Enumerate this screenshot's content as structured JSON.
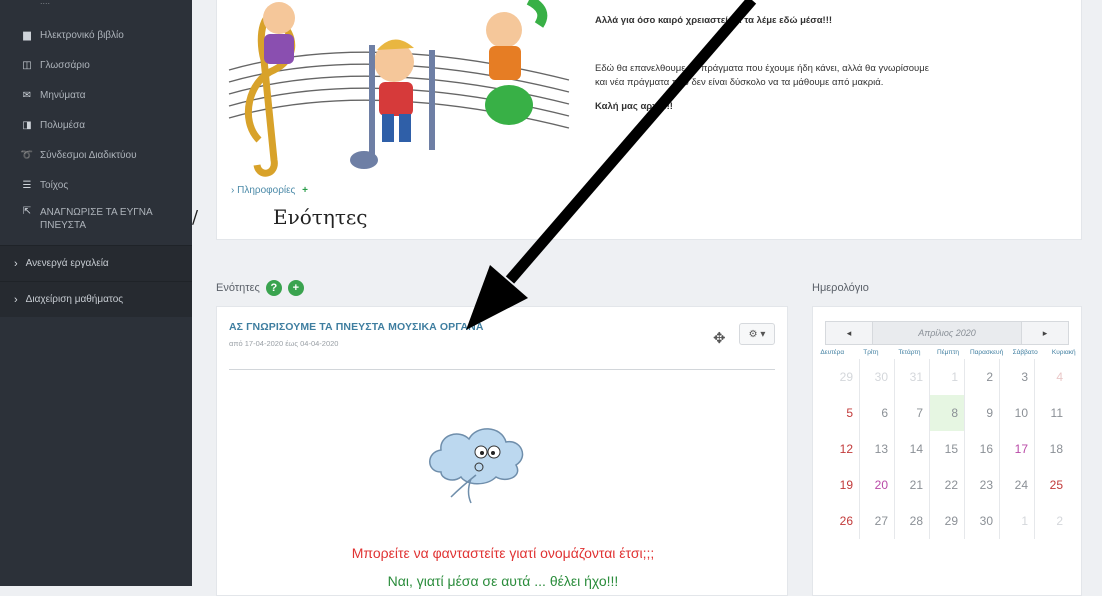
{
  "sidebar": {
    "top_partial": "....",
    "items": [
      {
        "icon": "book-icon",
        "glyph": "▆",
        "label": "Ηλεκτρονικό βιβλίο"
      },
      {
        "icon": "glossary-icon",
        "glyph": "◫",
        "label": "Γλωσσάριο"
      },
      {
        "icon": "message-icon",
        "glyph": "✉",
        "label": "Μηνύματα"
      },
      {
        "icon": "tools-icon",
        "glyph": "◨",
        "label": "Πολυμέσα"
      },
      {
        "icon": "link-icon",
        "glyph": "➰",
        "label": "Σύνδεσμοι Διαδικτύου"
      },
      {
        "icon": "wall-icon",
        "glyph": "☰",
        "label": "Τοίχος"
      },
      {
        "icon": "external-icon",
        "glyph": "⇱",
        "label": "ΑΝΑΓΝΩΡΙΣΕ ΤΑ ΕΥΓΝΑ ΠΝΕΥΣΤΑ"
      }
    ],
    "sections": [
      {
        "label": "Ανενεργά εργαλεία"
      },
      {
        "label": "Διαχείριση μαθήματος"
      }
    ]
  },
  "stray_mark": "/",
  "top_panel": {
    "lines": [
      {
        "text": "Αλλά για όσο καιρό χρειαστεί θα τα λέμε εδώ μέσα!!!",
        "bold": true
      },
      {
        "text": "Εδώ θα επανελθουμε σε πράγματα που έχουμε ήδη κάνει, αλλά θα γνωρίσουμε",
        "bold": false
      },
      {
        "text": "και νέα πράγματα που δεν είναι δύσκολο να τα μάθουμε από μακριά.",
        "bold": false
      },
      {
        "text": "Καλή μας αρχή!!!",
        "bold": true
      }
    ],
    "info_label": "Πληροφορίες",
    "handwritten_label": "Ενότητες"
  },
  "sections_panel": {
    "title": "Ενότητες",
    "help_glyph": "?",
    "add_glyph": "+",
    "unit": {
      "title": "ΑΣ ΓΝΩΡΙΣΟΥΜΕ ΤΑ ΠΝΕΥΣΤΑ ΜΟΥΣΙΚΑ ΟΡΓΑΝΑ",
      "date": "από 17-04-2020 έως 04-04-2020",
      "move_glyph": "✥",
      "gear_label": "⚙ ▾",
      "red_text": "Μπορείτε να φανταστείτε γιατί ονομάζονται έτσι;;;",
      "green_text": "Ναι, γιατί μέσα σε αυτά ... θέλει ήχο!!!"
    }
  },
  "calendar": {
    "title": "Ημερολόγιο",
    "prev": "◂",
    "next": "▸",
    "month": "Απρίλιος 2020",
    "weekdays": [
      "Δευτέρα",
      "Τρίτη",
      "Τετάρτη",
      "Πέμπτη",
      "Παρασκευή",
      "Σάββατο",
      "Κυριακή"
    ],
    "weeks": [
      [
        {
          "d": "29",
          "t": "other"
        },
        {
          "d": "30",
          "t": "other"
        },
        {
          "d": "31",
          "t": "other"
        },
        {
          "d": "1",
          "t": "other"
        },
        {
          "d": "2"
        },
        {
          "d": "3"
        },
        {
          "d": "4",
          "t": "other sun"
        }
      ],
      [
        {
          "d": "5",
          "t": "sun"
        },
        {
          "d": "6"
        },
        {
          "d": "7"
        },
        {
          "d": "8",
          "t": "today"
        },
        {
          "d": "9"
        },
        {
          "d": "10"
        },
        {
          "d": "11"
        }
      ],
      [
        {
          "d": "12",
          "t": "sun"
        },
        {
          "d": "13"
        },
        {
          "d": "14"
        },
        {
          "d": "15"
        },
        {
          "d": "16"
        },
        {
          "d": "17",
          "t": "holiday"
        },
        {
          "d": "18"
        }
      ],
      [
        {
          "d": "19",
          "t": "sun"
        },
        {
          "d": "20",
          "t": "holiday"
        },
        {
          "d": "21"
        },
        {
          "d": "22"
        },
        {
          "d": "23"
        },
        {
          "d": "24"
        },
        {
          "d": "25",
          "t": "sun"
        }
      ],
      [
        {
          "d": "26",
          "t": "sun"
        },
        {
          "d": "27"
        },
        {
          "d": "28"
        },
        {
          "d": "29"
        },
        {
          "d": "30"
        },
        {
          "d": "1",
          "t": "other"
        },
        {
          "d": "2",
          "t": "other"
        }
      ]
    ]
  },
  "colors": {
    "sidebar_bg": "#2c3139",
    "accent_green": "#3aa34f",
    "link_blue": "#3f7ea0",
    "red_text": "#e03333"
  }
}
